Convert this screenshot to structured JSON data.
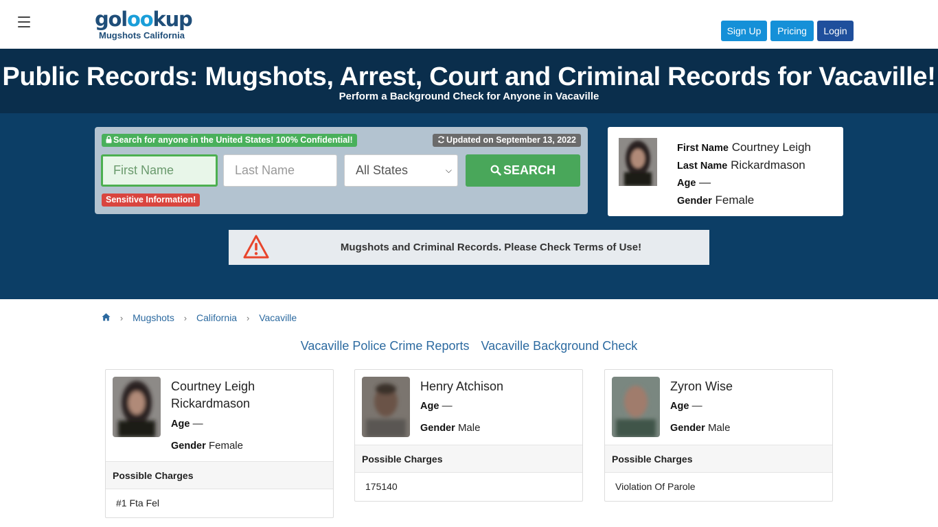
{
  "header": {
    "logo_text_a": "gol",
    "logo_text_oo": "oo",
    "logo_text_b": "kup",
    "logo_sub": "Mugshots California",
    "signup": "Sign Up",
    "pricing": "Pricing",
    "login": "Login"
  },
  "hero": {
    "title": "Public Records: Mugshots, Arrest, Court and Criminal Records for Vacaville!",
    "subtitle": "Perform a Background Check for Anyone in Vacaville"
  },
  "search": {
    "confidential_badge": "Search for anyone in the United States! 100% Confidential!",
    "updated_badge": "Updated on September 13, 2022",
    "first_name_placeholder": "First Name",
    "last_name_placeholder": "Last Name",
    "state_selected": "All States",
    "search_button": "SEARCH",
    "sensitive_badge": "Sensitive Information!"
  },
  "featured": {
    "first_name_label": "First Name",
    "first_name": "Courtney Leigh",
    "last_name_label": "Last Name",
    "last_name": "Rickardmason",
    "age_label": "Age",
    "age": "—",
    "gender_label": "Gender",
    "gender": "Female"
  },
  "notice": {
    "text": "Mugshots and Criminal Records. Please Check Terms of Use!"
  },
  "breadcrumb": {
    "items": [
      "Mugshots",
      "California",
      "Vacaville"
    ]
  },
  "links": {
    "police": "Vacaville Police Crime Reports",
    "background": "Vacaville Background Check"
  },
  "cards": [
    {
      "name": "Courtney Leigh Rickardmason",
      "age_label": "Age",
      "age": "—",
      "gender_label": "Gender",
      "gender": "Female",
      "charges_label": "Possible Charges",
      "charge": "#1 Fta Fel"
    },
    {
      "name": "Henry Atchison",
      "age_label": "Age",
      "age": "—",
      "gender_label": "Gender",
      "gender": "Male",
      "charges_label": "Possible Charges",
      "charge": "175140"
    },
    {
      "name": "Zyron Wise",
      "age_label": "Age",
      "age": "—",
      "gender_label": "Gender",
      "gender": "Male",
      "charges_label": "Possible Charges",
      "charge": "Violation Of Parole"
    }
  ],
  "colors": {
    "header_dark": "#0a2e4c",
    "hero_blue": "#0c3e66",
    "accent_green": "#49a75a",
    "link_blue": "#2c6aa0"
  }
}
